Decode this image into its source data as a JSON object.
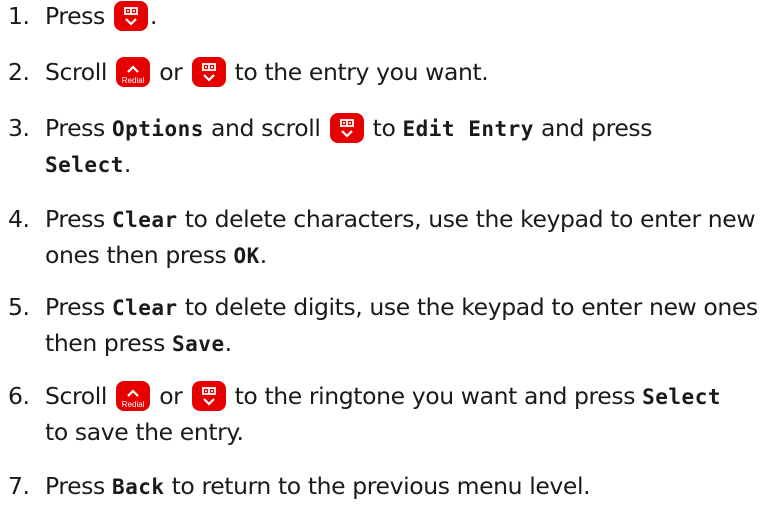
{
  "steps": [
    {
      "num": "1.",
      "t1": "Press",
      "t2": "."
    },
    {
      "num": "2.",
      "t1": "Scroll",
      "t2": "or",
      "t3": "to the entry you want."
    },
    {
      "num": "3.",
      "t1": "Press",
      "d1": "Options",
      "t2": "and scroll",
      "t3": "to",
      "d2": "Edit Entry",
      "t4": "and press",
      "d3": "Select",
      "t5": "."
    },
    {
      "num": "4.",
      "t1": "Press",
      "d1": "Clear",
      "t2": "to delete characters, use the keypad to enter new",
      "t3": "ones then press",
      "d2": "OK",
      "t4": "."
    },
    {
      "num": "5.",
      "t1": "Press",
      "d1": "Clear",
      "t2": "to delete digits, use the keypad to enter new ones",
      "t3": "then press",
      "d2": "Save",
      "t4": "."
    },
    {
      "num": "6.",
      "t1": "Scroll",
      "t2": "or",
      "t3": "to the ringtone you want and press",
      "d1": "Select",
      "t4": "to save the entry."
    },
    {
      "num": "7.",
      "t1": "Press",
      "d1": "Back",
      "t2": "to return to the previous menu level."
    }
  ],
  "icons": {
    "phonebook": "phonebook-down-icon",
    "redial": "redial-up-icon",
    "redial_label": "Redial"
  },
  "colors": {
    "key": "#e60000",
    "text": "#1a1a1a"
  }
}
